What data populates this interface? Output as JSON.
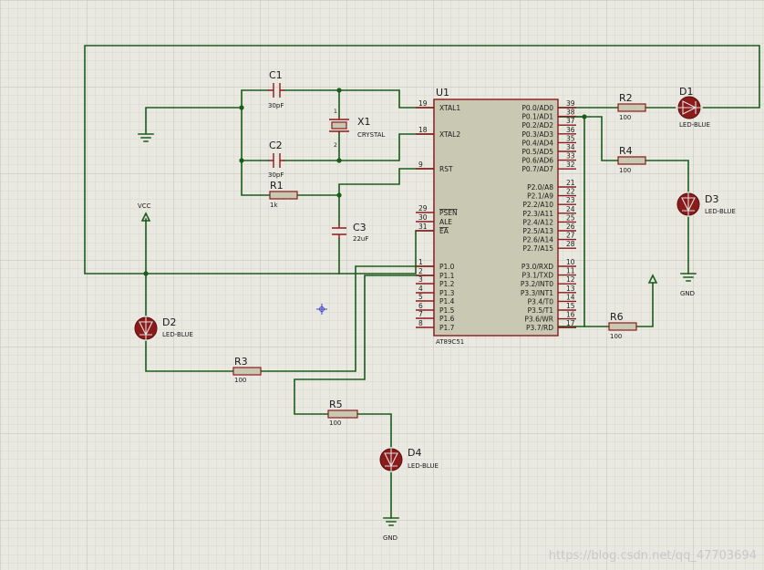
{
  "watermark": "https://blog.csdn.net/qq_47703694",
  "colors": {
    "wire": "#1a5c1a",
    "component": "#8b1a1a",
    "led_fill": "#8b1a1a",
    "chip_fill": "#c9c9b3",
    "grid_minor": "#d6d6ca",
    "grid_major": "#c0c0b2",
    "background": "#e9e9e1"
  },
  "mcu": {
    "ref": "U1",
    "part": "AT89C51",
    "left_pins": [
      {
        "num": "19",
        "name": "XTAL1"
      },
      {
        "num": "18",
        "name": "XTAL2"
      },
      {
        "num": "9",
        "name": "RST"
      },
      {
        "num": "29",
        "name": "PSEN"
      },
      {
        "num": "30",
        "name": "ALE"
      },
      {
        "num": "31",
        "name": "EA"
      },
      {
        "num": "1",
        "name": "P1.0"
      },
      {
        "num": "2",
        "name": "P1.1"
      },
      {
        "num": "3",
        "name": "P1.2"
      },
      {
        "num": "4",
        "name": "P1.3"
      },
      {
        "num": "5",
        "name": "P1.4"
      },
      {
        "num": "6",
        "name": "P1.5"
      },
      {
        "num": "7",
        "name": "P1.6"
      },
      {
        "num": "8",
        "name": "P1.7"
      }
    ],
    "right_pins": [
      {
        "num": "39",
        "name": "P0.0/AD0"
      },
      {
        "num": "38",
        "name": "P0.1/AD1"
      },
      {
        "num": "37",
        "name": "P0.2/AD2"
      },
      {
        "num": "36",
        "name": "P0.3/AD3"
      },
      {
        "num": "35",
        "name": "P0.4/AD4"
      },
      {
        "num": "34",
        "name": "P0.5/AD5"
      },
      {
        "num": "33",
        "name": "P0.6/AD6"
      },
      {
        "num": "32",
        "name": "P0.7/AD7"
      },
      {
        "num": "21",
        "name": "P2.0/A8"
      },
      {
        "num": "22",
        "name": "P2.1/A9"
      },
      {
        "num": "23",
        "name": "P2.2/A10"
      },
      {
        "num": "24",
        "name": "P2.3/A11"
      },
      {
        "num": "25",
        "name": "P2.4/A12"
      },
      {
        "num": "26",
        "name": "P2.5/A13"
      },
      {
        "num": "27",
        "name": "P2.6/A14"
      },
      {
        "num": "28",
        "name": "P2.7/A15"
      },
      {
        "num": "10",
        "name": "P3.0/RXD"
      },
      {
        "num": "11",
        "name": "P3.1/TXD"
      },
      {
        "num": "12",
        "name": "P3.2/INT0"
      },
      {
        "num": "13",
        "name": "P3.3/INT1"
      },
      {
        "num": "14",
        "name": "P3.4/T0"
      },
      {
        "num": "15",
        "name": "P3.5/T1"
      },
      {
        "num": "16",
        "name": "P3.6/WR"
      },
      {
        "num": "17",
        "name": "P3.7/RD"
      }
    ]
  },
  "components": {
    "c1": {
      "ref": "C1",
      "value": "30pF"
    },
    "c2": {
      "ref": "C2",
      "value": "30pF"
    },
    "c3": {
      "ref": "C3",
      "value": "22uF"
    },
    "x1": {
      "ref": "X1",
      "value": "CRYSTAL",
      "pin1": "1",
      "pin2": "2"
    },
    "r1": {
      "ref": "R1",
      "value": "1k"
    },
    "r2": {
      "ref": "R2",
      "value": "100"
    },
    "r3": {
      "ref": "R3",
      "value": "100"
    },
    "r4": {
      "ref": "R4",
      "value": "100"
    },
    "r5": {
      "ref": "R5",
      "value": "100"
    },
    "r6": {
      "ref": "R6",
      "value": "100"
    },
    "d1": {
      "ref": "D1",
      "value": "LED-BLUE"
    },
    "d2": {
      "ref": "D2",
      "value": "LED-BLUE"
    },
    "d3": {
      "ref": "D3",
      "value": "LED-BLUE"
    },
    "d4": {
      "ref": "D4",
      "value": "LED-BLUE"
    }
  },
  "power": {
    "vcc": "VCC",
    "gnd_d3": "GND",
    "gnd_d4": "GND"
  }
}
